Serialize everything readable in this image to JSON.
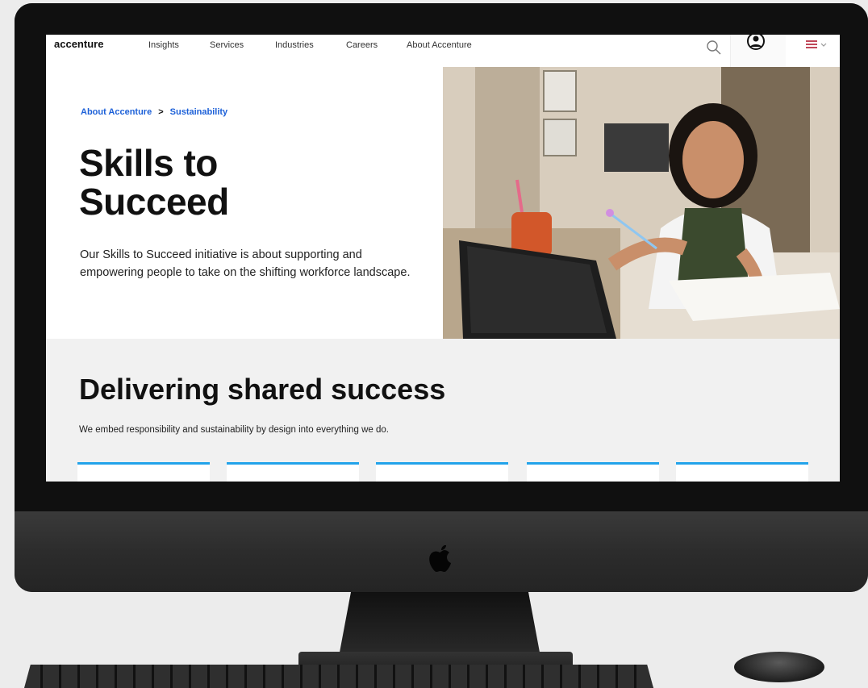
{
  "nav": {
    "logo": "accenture",
    "items": [
      "Insights",
      "Services",
      "Industries",
      "Careers",
      "About Accenture"
    ]
  },
  "hero": {
    "breadcrumb": [
      "About Accenture",
      "Sustainability"
    ],
    "breadcrumb_separator": ">",
    "title_line1": "Skills to",
    "title_line2": "Succeed",
    "description": "Our Skills to Succeed initiative is about supporting and empowering people to take on the shifting workforce landscape."
  },
  "section": {
    "title": "Delivering shared success",
    "subtitle": "We embed responsibility and sustainability by design into everything we do."
  },
  "colors": {
    "link": "#1c60d8",
    "card_accent": "#22a3ea",
    "section_bg": "#f1f1f1"
  },
  "icons": [
    "search-icon",
    "user-icon",
    "menu-icon",
    "apple-logo-icon"
  ]
}
